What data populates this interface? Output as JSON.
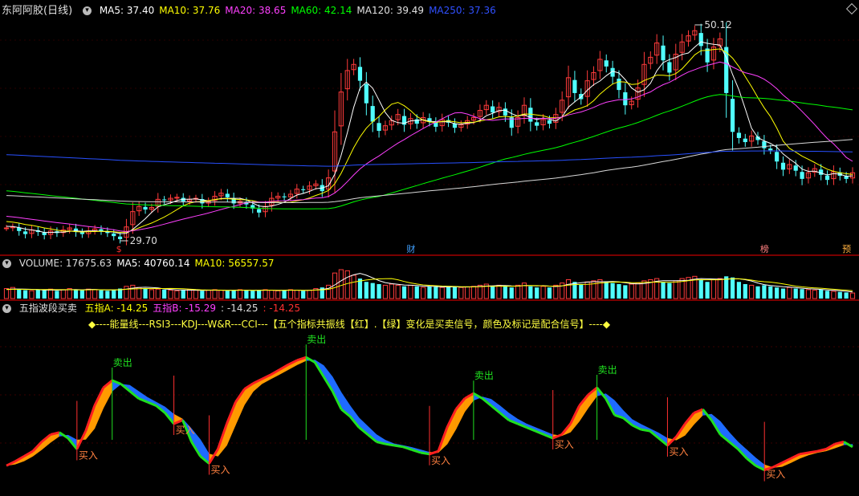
{
  "price_panel": {
    "stock_name": "东阿阿胶(日线)",
    "ma_labels": [
      {
        "text": "MA5: 37.40",
        "color": "#ffffff"
      },
      {
        "text": "MA10: 37.76",
        "color": "#ffff00"
      },
      {
        "text": "MA20: 38.65",
        "color": "#ff40ff"
      },
      {
        "text": "MA60: 42.14",
        "color": "#00ff00"
      },
      {
        "text": "MA120: 39.49",
        "color": "#e0e0e0"
      },
      {
        "text": "MA250: 37.36",
        "color": "#3050ff"
      }
    ],
    "high_label": "50.12",
    "low_label": "29.70",
    "markers": [
      {
        "text": "$",
        "color": "#ff3030"
      },
      {
        "text": "财",
        "color": "#40a0ff"
      },
      {
        "text": "榜",
        "color": "#ff8080"
      },
      {
        "text": "预",
        "color": "#ffb040"
      }
    ]
  },
  "volume_panel": {
    "labels": [
      {
        "text": "VOLUME: 17675.63",
        "color": "#dddddd"
      },
      {
        "text": "MA5: 40760.14",
        "color": "#ffffff"
      },
      {
        "text": "MA10: 56557.57",
        "color": "#ffff00"
      }
    ]
  },
  "indicator_panel": {
    "name": "五指波段买卖",
    "labels": [
      {
        "text": "五指A: -14.25",
        "color": "#ffff00"
      },
      {
        "text": "五指B: -15.29",
        "color": "#ff40ff"
      },
      {
        "text": ": -14.25",
        "color": "#dddddd"
      },
      {
        "text": ": -14.25",
        "color": "#ff3030"
      }
    ],
    "hint": "◆----能量线---RSI3---KDJ---W&R---CCI---【五个指标共振线【红】.【绿】变化是买卖信号，颜色及标记是配合信号】----◆",
    "buy_label": "买入",
    "sell_label": "卖出"
  },
  "chart_data": [
    {
      "type": "candlestick",
      "title": "东阿阿胶(日线)",
      "close": [
        30.8,
        30.9,
        30.5,
        30.2,
        30.6,
        30.4,
        30.1,
        30.5,
        30.3,
        30.6,
        30.8,
        30.4,
        30.2,
        30.5,
        30.7,
        30.5,
        30.3,
        30.0,
        29.7,
        30.9,
        32.4,
        32.9,
        32.6,
        32.8,
        33.6,
        33.5,
        33.7,
        33.8,
        33.4,
        33.6,
        33.7,
        33.2,
        33.4,
        33.9,
        34.2,
        33.8,
        33.2,
        33.4,
        33.1,
        32.7,
        32.3,
        32.9,
        33.7,
        33.9,
        33.8,
        34.1,
        34.6,
        34.5,
        34.9,
        35.1,
        34.4,
        35.7,
        40.2,
        44.1,
        46.2,
        46.8,
        45.2,
        43.0,
        41.2,
        40.3,
        40.8,
        41.3,
        41.9,
        40.9,
        41.5,
        41.0,
        41.6,
        41.2,
        40.7,
        41.4,
        41.1,
        40.6,
        40.9,
        41.3,
        41.6,
        42.3,
        42.8,
        42.1,
        42.6,
        41.8,
        40.6,
        41.6,
        42.8,
        41.2,
        40.8,
        41.4,
        41.0,
        41.9,
        43.3,
        45.5,
        44.0,
        43.4,
        45.2,
        46.0,
        47.3,
        46.6,
        45.6,
        44.3,
        42.8,
        43.2,
        44.5,
        46.8,
        47.5,
        48.9,
        47.2,
        46.0,
        47.8,
        49.0,
        49.6,
        50.1,
        48.6,
        47.0,
        48.5,
        49.3,
        44.0,
        40.2,
        39.6,
        39.2,
        39.8,
        39.4,
        38.6,
        38.4,
        37.3,
        36.5,
        37.0,
        36.4,
        35.6,
        36.2,
        36.6,
        36.0,
        35.5,
        36.3,
        35.9,
        35.6,
        36.2
      ],
      "ma_series": [
        "MA5",
        "MA10",
        "MA20",
        "MA60",
        "MA120",
        "MA250"
      ],
      "price_range": [
        29.7,
        50.12
      ]
    },
    {
      "type": "bar",
      "title": "VOLUME",
      "values": [
        18,
        20,
        16,
        15,
        14,
        16,
        15,
        17,
        14,
        16,
        18,
        16,
        15,
        17,
        16,
        15,
        14,
        16,
        18,
        22,
        24,
        20,
        18,
        16,
        17,
        16,
        15,
        14,
        15,
        16,
        15,
        14,
        15,
        16,
        15,
        14,
        15,
        16,
        15,
        14,
        15,
        16,
        15,
        14,
        15,
        16,
        15,
        14,
        15,
        18,
        20,
        24,
        46,
        52,
        50,
        42,
        36,
        30,
        28,
        26,
        24,
        26,
        24,
        22,
        24,
        22,
        20,
        22,
        21,
        20,
        21,
        22,
        20,
        21,
        22,
        24,
        26,
        22,
        24,
        22,
        20,
        24,
        28,
        22,
        20,
        22,
        20,
        24,
        28,
        34,
        30,
        26,
        30,
        32,
        34,
        30,
        28,
        26,
        24,
        26,
        28,
        32,
        34,
        36,
        30,
        28,
        32,
        36,
        38,
        40,
        34,
        30,
        34,
        36,
        40,
        38,
        30,
        26,
        24,
        22,
        24,
        22,
        20,
        18,
        20,
        18,
        17,
        16,
        15,
        16,
        14,
        13,
        12,
        11,
        10
      ],
      "ma_series": [
        "MA5",
        "MA10"
      ]
    },
    {
      "type": "area",
      "title": "五指波段买卖",
      "series": [
        {
          "name": "五指A",
          "values": [
            -78,
            -72,
            -65,
            -58,
            -45,
            -35,
            -32,
            -40,
            -55,
            -30,
            5,
            30,
            40,
            35,
            25,
            15,
            10,
            5,
            -5,
            -20,
            -15,
            -45,
            -65,
            -75,
            -55,
            -20,
            10,
            28,
            36,
            42,
            48,
            55,
            62,
            68,
            72,
            65,
            45,
            25,
            0,
            -10,
            -25,
            -35,
            -45,
            -48,
            -50,
            -52,
            -56,
            -60,
            -62,
            -58,
            -25,
            0,
            15,
            22,
            15,
            5,
            -5,
            -15,
            -20,
            -25,
            -30,
            -35,
            -40,
            -35,
            -20,
            5,
            20,
            30,
            15,
            -8,
            -12,
            -22,
            -28,
            -30,
            -40,
            -50,
            -38,
            -20,
            -5,
            0,
            -15,
            -35,
            -45,
            -55,
            -68,
            -78,
            -84,
            -80,
            -74,
            -68,
            -62,
            -60,
            -58,
            -55,
            -48,
            -45,
            -52
          ]
        }
      ],
      "value_range": [
        -100,
        100
      ]
    }
  ]
}
